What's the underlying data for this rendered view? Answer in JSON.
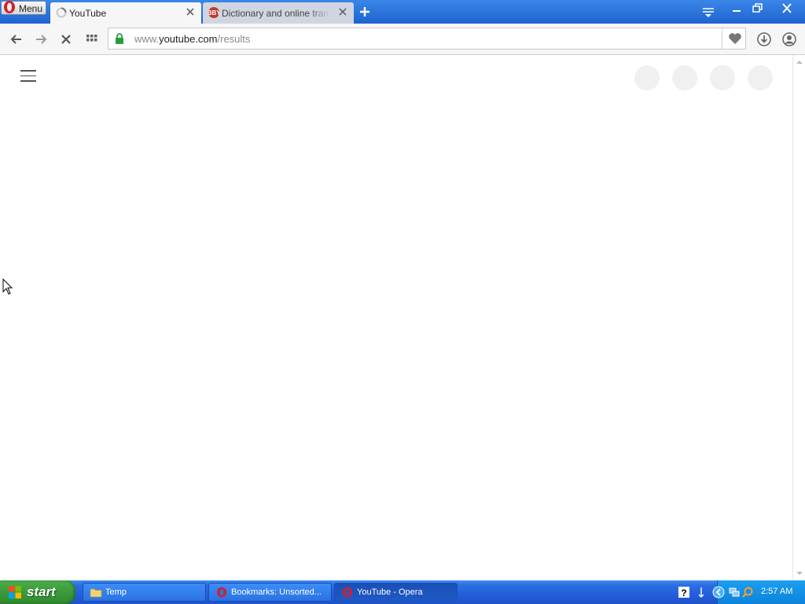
{
  "browser": {
    "menu_label": "Menu",
    "tabs": [
      {
        "title": "YouTube",
        "state": "loading"
      },
      {
        "title": "Dictionary and online translation"
      }
    ],
    "address": {
      "prefix": "www.",
      "host": "youtube.com",
      "path": "/results"
    }
  },
  "taskbar": {
    "start_label": "start",
    "tasks": [
      {
        "label": "Temp"
      },
      {
        "label": "Bookmarks: Unsorted..."
      },
      {
        "label": "YouTube - Opera"
      }
    ],
    "clock": "2:57 AM"
  },
  "colors": {
    "titlebar": "#2a6fdc",
    "taskbar": "#245edb",
    "start_button": "#3b9a3b",
    "lock": "#2e9b3a"
  }
}
